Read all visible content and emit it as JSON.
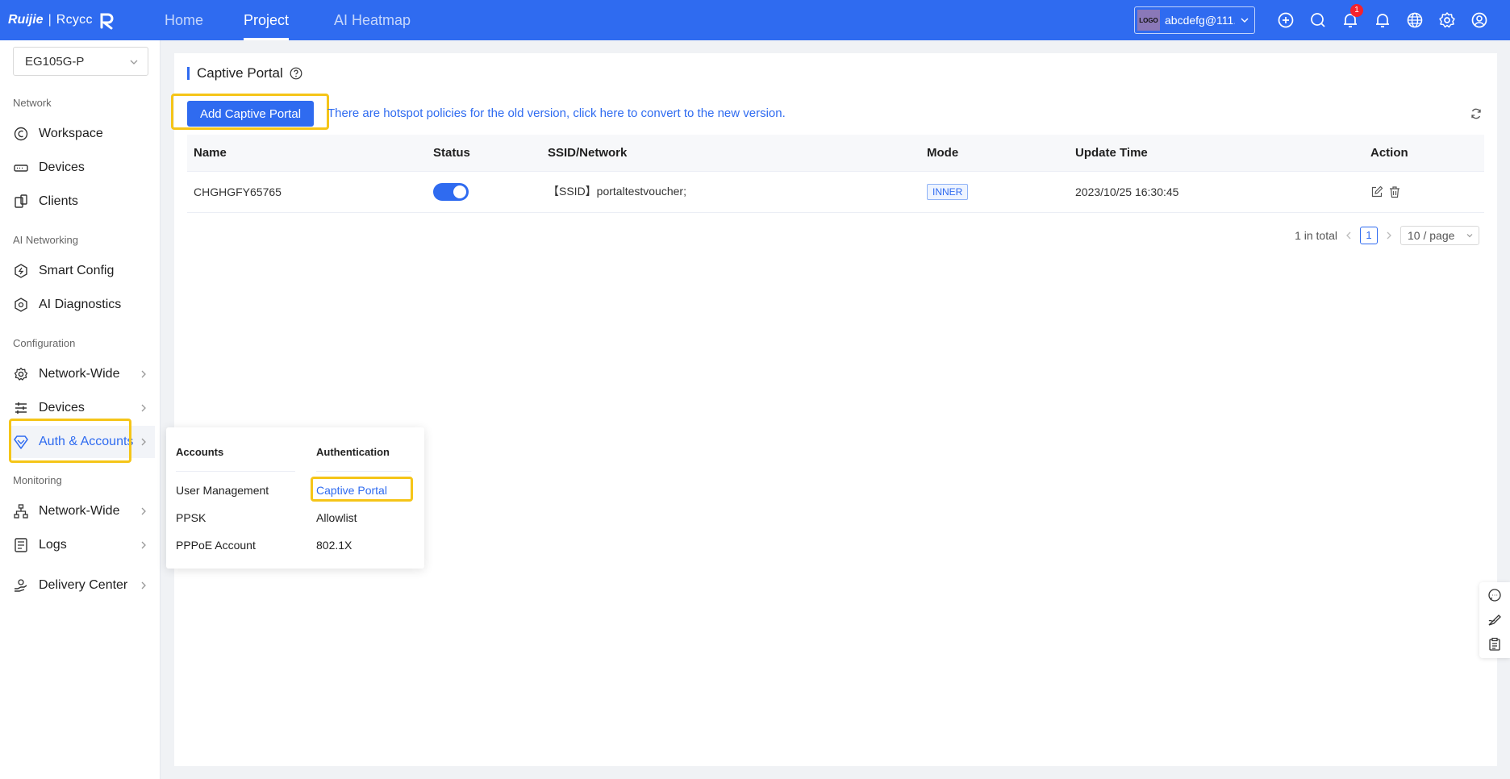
{
  "brand": {
    "name_a": "Ruijie",
    "separator": "|",
    "name_b": "Rcycc"
  },
  "nav": {
    "tabs": [
      {
        "label": "Home"
      },
      {
        "label": "Project",
        "active": true
      },
      {
        "label": "AI Heatmap"
      }
    ]
  },
  "account": {
    "logo": "LOGO",
    "name": "abcdefg@111...."
  },
  "top_icons": [
    "add-icon",
    "search-icon",
    "notification-icon",
    "bell-icon",
    "globe-icon",
    "settings-icon",
    "user-icon"
  ],
  "notifications": {
    "count": "1"
  },
  "sidebar": {
    "device": "EG105G-P",
    "groups": [
      {
        "label": "Network"
      },
      {
        "label": "AI Networking"
      },
      {
        "label": "Configuration"
      },
      {
        "label": "Monitoring"
      }
    ],
    "items": [
      {
        "label": "Workspace"
      },
      {
        "label": "Devices"
      },
      {
        "label": "Clients"
      },
      {
        "label": "Smart Config"
      },
      {
        "label": "AI Diagnostics"
      },
      {
        "label": "Network-Wide"
      },
      {
        "label": "Devices"
      },
      {
        "label": "Auth & Accounts"
      },
      {
        "label": "Network-Wide"
      },
      {
        "label": "Logs"
      },
      {
        "label": "Delivery Center"
      }
    ]
  },
  "flyout": {
    "accounts_title": "Accounts",
    "accounts_items": [
      {
        "label": "User Management"
      },
      {
        "label": "PPSK"
      },
      {
        "label": "PPPoE Account"
      }
    ],
    "auth_title": "Authentication",
    "auth_items": [
      {
        "label": "Captive Portal"
      },
      {
        "label": "Allowlist"
      },
      {
        "label": "802.1X"
      }
    ]
  },
  "page": {
    "title": "Captive Portal",
    "add_button": "Add Captive Portal",
    "old_version_link": "There are hotspot policies for the old version, click here to convert to the new version."
  },
  "table": {
    "columns": [
      "Name",
      "Status",
      "SSID/Network",
      "Mode",
      "Update Time",
      "Action"
    ],
    "rows": [
      {
        "name": "CHGHGFY65765",
        "status": "on",
        "ssid": "【SSID】portaltestvoucher;",
        "mode": "INNER",
        "update_time": "2023/10/25 16:30:45"
      }
    ]
  },
  "pagination": {
    "total": "1 in total",
    "current_page": "1",
    "page_size": "10 / page"
  },
  "colors": {
    "primary": "#2f6bf0",
    "highlight": "#f5c518"
  }
}
